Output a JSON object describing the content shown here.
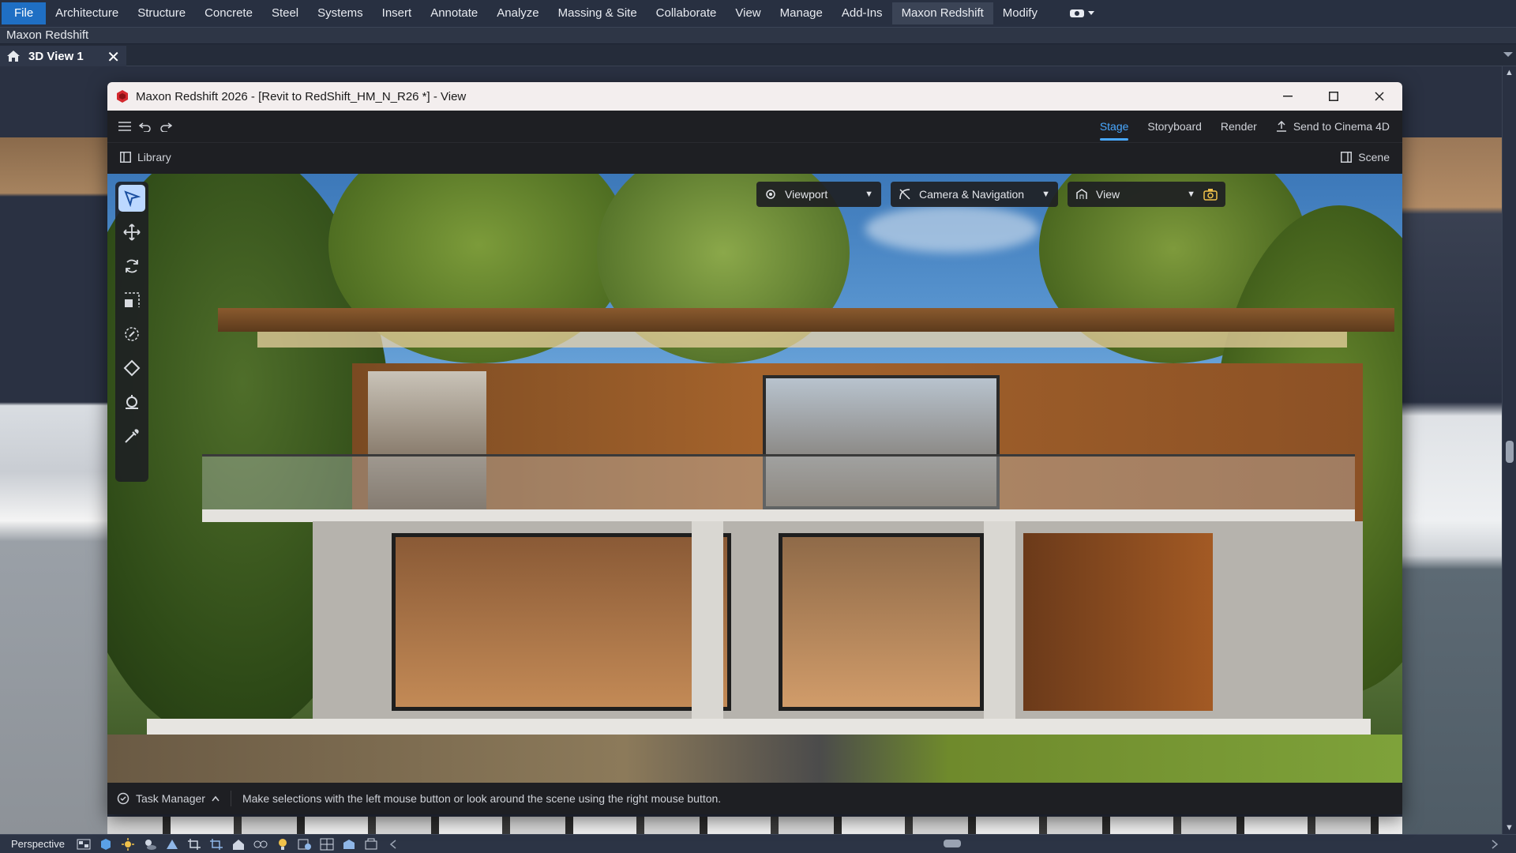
{
  "ribbon": {
    "tabs": [
      "File",
      "Architecture",
      "Structure",
      "Concrete",
      "Steel",
      "Systems",
      "Insert",
      "Annotate",
      "Analyze",
      "Massing & Site",
      "Collaborate",
      "View",
      "Manage",
      "Add-Ins",
      "Maxon Redshift",
      "Modify"
    ],
    "active_tab": "Maxon Redshift",
    "panel_title": "Maxon Redshift"
  },
  "view_tab": {
    "title": "3D View 1",
    "close": "✕"
  },
  "view_control": {
    "label": "Perspective"
  },
  "redshift": {
    "window_title": "Maxon Redshift 2026 - [Revit to RedShift_HM_N_R26 *] - View",
    "top_tabs": [
      "Stage",
      "Storyboard",
      "Render"
    ],
    "active_tab": "Stage",
    "send_label": "Send to Cinema 4D",
    "library_label": "Library",
    "scene_label": "Scene",
    "dropdowns": {
      "viewport": "Viewport",
      "camera": "Camera & Navigation",
      "view": "View"
    },
    "status": {
      "task_manager": "Task Manager",
      "message": "Make selections with the left mouse button or look around the scene using the right mouse button."
    }
  },
  "colors": {
    "accent": "#49a8ff",
    "file_tab": "#1f6fc4",
    "brand_red": "#d4282e"
  }
}
